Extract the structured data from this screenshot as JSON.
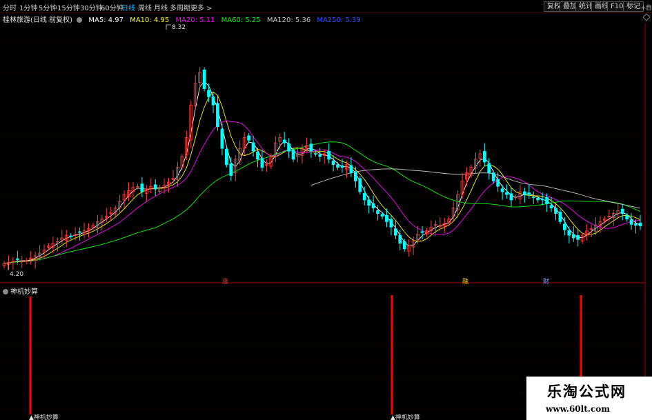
{
  "toolbar": {
    "timeframes": [
      {
        "label": "分时",
        "active": false
      },
      {
        "label": "1分钟",
        "active": false
      },
      {
        "label": "5分钟",
        "active": false
      },
      {
        "label": "15分钟",
        "active": false
      },
      {
        "label": "30分钟",
        "active": false
      },
      {
        "label": "60分钟",
        "active": false
      },
      {
        "label": "日线",
        "active": true
      },
      {
        "label": "周线",
        "active": false
      },
      {
        "label": "月线",
        "active": false
      },
      {
        "label": "多周期",
        "active": false
      },
      {
        "label": "更多 >",
        "active": false
      }
    ],
    "buttons": [
      "复权",
      "叠加",
      "统计",
      "画线",
      "F10",
      "标记"
    ],
    "extra": "+自"
  },
  "main_chart": {
    "stock_label": "桂林旅游(日线 前复权)",
    "ma_legend": [
      {
        "label": "MA5: 4.97",
        "color": "#ffffff"
      },
      {
        "label": "MA10: 4.95",
        "color": "#ffff00"
      },
      {
        "label": "MA20: 5.11",
        "color": "#ff00ff"
      },
      {
        "label": "MA60: 5.25",
        "color": "#00ff00"
      },
      {
        "label": "MA120: 5.36",
        "color": "#c8c8c8"
      },
      {
        "label": "MA250: 5.39",
        "color": "#3050ff"
      }
    ],
    "high_label": "8.32",
    "low_label": "4.20",
    "event_tags": [
      {
        "label": "涨",
        "color": "#ff4040"
      },
      {
        "label": "融",
        "color": "#ffcc00"
      },
      {
        "label": "财",
        "color": "#80a0ff"
      }
    ]
  },
  "indicator": {
    "title": "神机妙算",
    "signal_label": "▲神机妙算",
    "signal_color": "#ff0000"
  },
  "watermark": {
    "title": "乐淘公式网",
    "url": "www.60lt.com"
  },
  "chart_data": {
    "type": "candlestick",
    "ylim": [
      4.0,
      8.6
    ],
    "closes": [
      4.28,
      4.3,
      4.32,
      4.35,
      4.32,
      4.33,
      4.38,
      4.42,
      4.47,
      4.53,
      4.6,
      4.65,
      4.68,
      4.75,
      4.8,
      4.78,
      4.82,
      4.85,
      4.88,
      4.92,
      4.98,
      5.05,
      5.1,
      5.15,
      5.22,
      5.3,
      5.42,
      5.55,
      5.62,
      5.68,
      5.7,
      5.6,
      5.65,
      5.7,
      5.65,
      5.68,
      5.72,
      5.78,
      5.85,
      6.05,
      6.25,
      6.6,
      7.2,
      7.6,
      7.8,
      7.5,
      7.35,
      7.2,
      6.8,
      6.4,
      6.1,
      5.9,
      6.2,
      6.4,
      6.6,
      6.55,
      6.35,
      6.2,
      6.05,
      6.1,
      6.25,
      6.5,
      6.6,
      6.5,
      6.35,
      6.2,
      6.3,
      6.4,
      6.45,
      6.35,
      6.3,
      6.25,
      6.3,
      6.2,
      6.1,
      6.05,
      6.05,
      6.1,
      5.95,
      5.8,
      5.6,
      5.45,
      5.35,
      5.3,
      5.2,
      5.15,
      5.05,
      4.95,
      4.8,
      4.65,
      4.55,
      4.6,
      4.7,
      4.82,
      4.85,
      4.88,
      4.95,
      5.0,
      4.98,
      5.02,
      5.1,
      5.3,
      5.55,
      5.8,
      5.95,
      6.05,
      6.2,
      6.3,
      6.15,
      5.95,
      5.8,
      5.7,
      5.6,
      5.55,
      5.45,
      5.5,
      5.6,
      5.55,
      5.55,
      5.5,
      5.45,
      5.45,
      5.38,
      5.3,
      5.2,
      5.05,
      4.9,
      4.8,
      4.75,
      4.72,
      4.8,
      4.88,
      4.92,
      4.98,
      5.05,
      5.1,
      5.15,
      5.2,
      5.25,
      5.2,
      5.1,
      5.0,
      4.98,
      4.97
    ]
  }
}
